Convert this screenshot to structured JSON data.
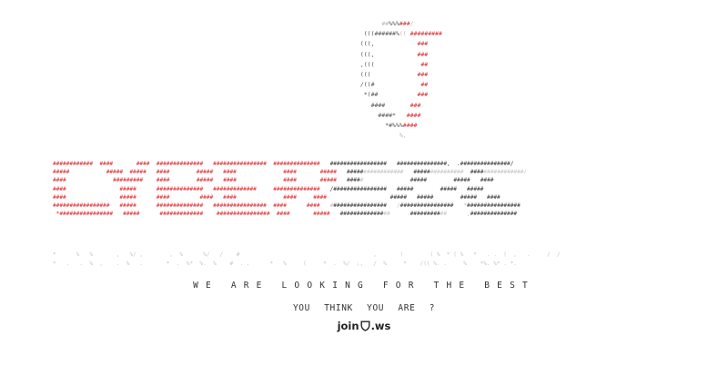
{
  "tagline": "WE ARE LOOKING FOR THE BEST",
  "subline": "YOU THINK YOU ARE ?",
  "join_link": {
    "prefix": "join",
    "suffix": ".ws"
  },
  "colors": {
    "accent": "#d8262b",
    "ink": "#222222",
    "faint": "#c4c4c4"
  },
  "icons": {
    "logo": "shield-icon"
  }
}
